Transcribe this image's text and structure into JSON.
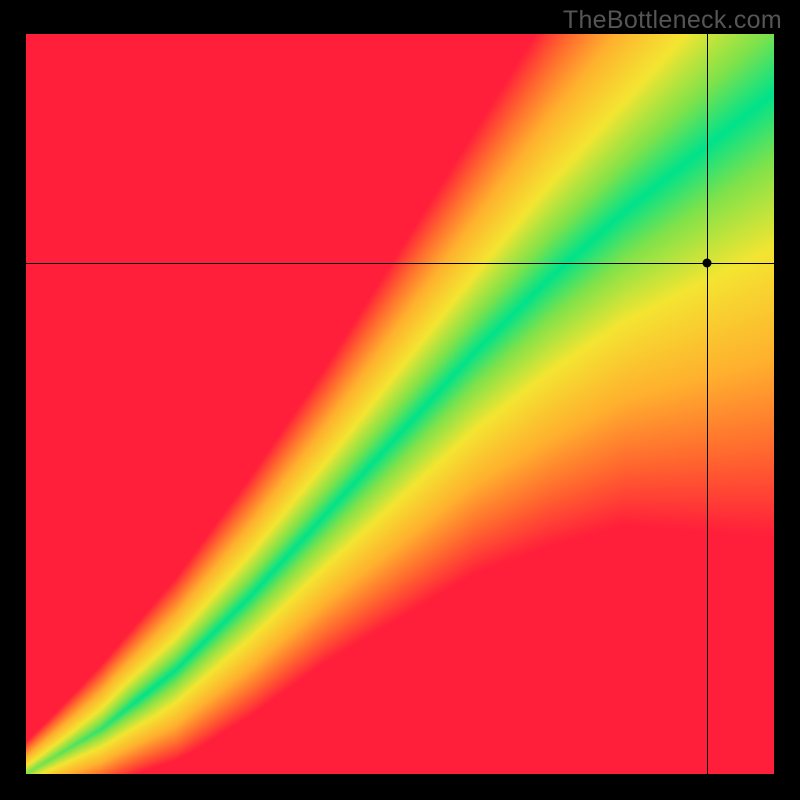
{
  "watermark": "TheBottleneck.com",
  "chart_data": {
    "type": "heatmap",
    "title": "",
    "xlabel": "",
    "ylabel": "",
    "xlim": [
      0,
      100
    ],
    "ylim": [
      0,
      100
    ],
    "grid": false,
    "legend": false,
    "description": "Continuous 2D heatmap. A narrow green 'optimal' band runs along a slightly super-linear diagonal from bottom-left to top-right, widening toward the upper-right. Regions far from the diagonal fade through yellow to red.",
    "color_stops": [
      {
        "t": 0.0,
        "color": "#00e28a"
      },
      {
        "t": 0.15,
        "color": "#7fe24a"
      },
      {
        "t": 0.35,
        "color": "#f4e531"
      },
      {
        "t": 0.6,
        "color": "#ffb02e"
      },
      {
        "t": 0.8,
        "color": "#ff6a2e"
      },
      {
        "t": 1.0,
        "color": "#ff1f3a"
      }
    ],
    "diagonal_curve_samples": [
      {
        "x": 0,
        "y": 0
      },
      {
        "x": 10,
        "y": 6
      },
      {
        "x": 20,
        "y": 14
      },
      {
        "x": 30,
        "y": 24
      },
      {
        "x": 40,
        "y": 35
      },
      {
        "x": 50,
        "y": 46
      },
      {
        "x": 60,
        "y": 57
      },
      {
        "x": 70,
        "y": 67
      },
      {
        "x": 80,
        "y": 76
      },
      {
        "x": 90,
        "y": 84
      },
      {
        "x": 100,
        "y": 92
      }
    ],
    "band_halfwidth_samples": [
      {
        "x": 0,
        "w": 1.0
      },
      {
        "x": 20,
        "w": 2.5
      },
      {
        "x": 40,
        "w": 4.0
      },
      {
        "x": 60,
        "w": 6.0
      },
      {
        "x": 80,
        "w": 8.5
      },
      {
        "x": 100,
        "w": 12.0
      }
    ],
    "marker": {
      "x": 91,
      "y": 69
    },
    "crosshair": {
      "x": 91,
      "y": 69
    }
  }
}
